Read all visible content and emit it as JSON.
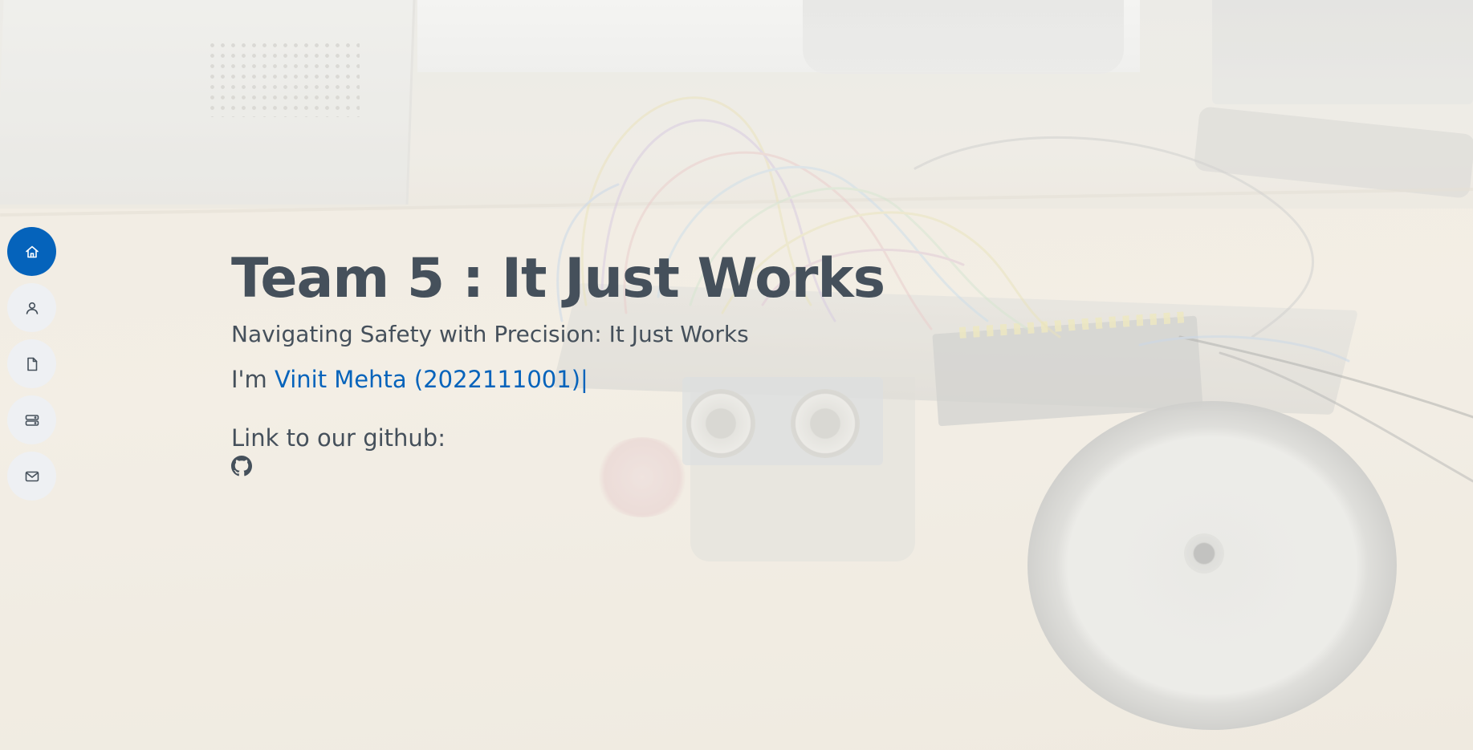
{
  "hero": {
    "title": "Team 5 : It Just Works",
    "subtitle": "Navigating Safety with Precision: It Just Works",
    "intro_prefix": "I'm",
    "name": "Vinit Mehta (2022111001)",
    "cursor": "|",
    "github_label": "Link to our github:",
    "github_icon": "github-icon"
  },
  "nav": {
    "items": [
      {
        "icon": "home-icon",
        "active": true
      },
      {
        "icon": "person-icon",
        "active": false
      },
      {
        "icon": "file-icon",
        "active": false
      },
      {
        "icon": "server-icon",
        "active": false
      },
      {
        "icon": "envelope-icon",
        "active": false
      }
    ]
  },
  "colors": {
    "accent": "#0563bb",
    "text": "#45505b",
    "nav_bg": "#eef0f3"
  }
}
